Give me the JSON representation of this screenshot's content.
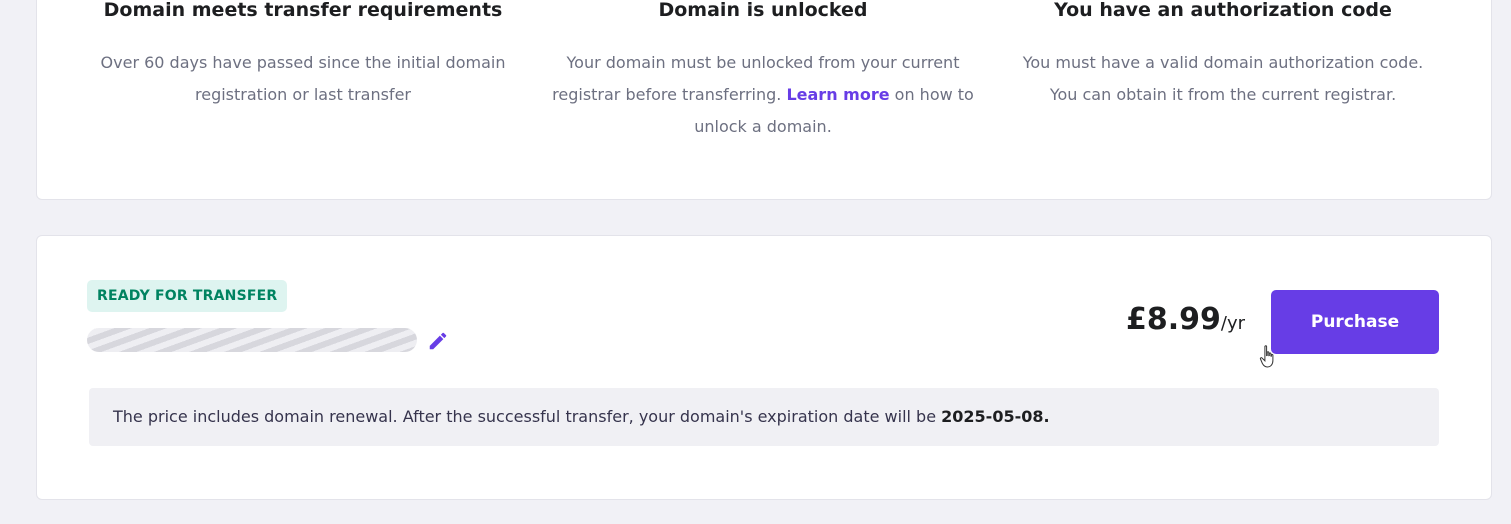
{
  "requirements": [
    {
      "title": "Domain meets transfer requirements",
      "desc_before": "Over 60 days have passed since the initial domain registration or last transfer",
      "link": "",
      "desc_after": ""
    },
    {
      "title": "Domain is unlocked",
      "desc_before": "Your domain must be unlocked from your current registrar before transferring.",
      "link": "Learn more",
      "desc_after": "on how to unlock a domain."
    },
    {
      "title": "You have an authorization code",
      "desc_before": "You must have a valid domain authorization code. You can obtain it from the current registrar.",
      "link": "",
      "desc_after": ""
    }
  ],
  "transfer": {
    "status_badge": "READY FOR TRANSFER",
    "domain_name": "",
    "price": "£8.99",
    "price_period": "/yr",
    "purchase_label": "Purchase",
    "info_text": "The price includes domain renewal. After the successful transfer, your domain's expiration date will be",
    "expiration_date": "2025-05-08."
  },
  "colors": {
    "accent": "#673de6",
    "badge_bg": "#def4f0",
    "badge_text": "#008361"
  },
  "icons": {
    "edit": "pencil-icon",
    "cursor": "hand-pointer-icon"
  }
}
